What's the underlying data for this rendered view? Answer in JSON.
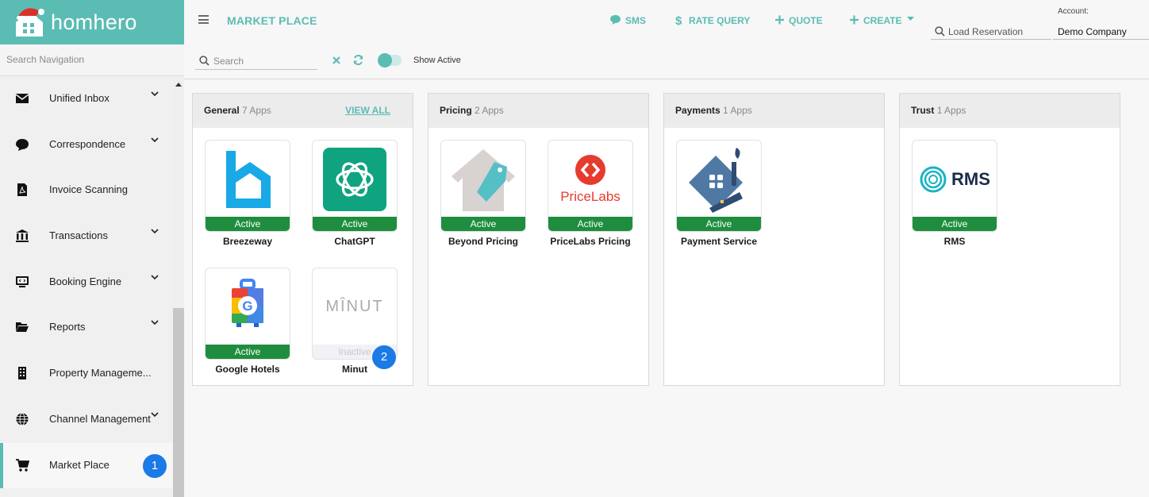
{
  "brand": {
    "name": "homhero",
    "accent": "#5bbcb4"
  },
  "sidebar": {
    "search_placeholder": "Search Navigation",
    "items": [
      {
        "label": "Unified Inbox",
        "icon": "envelope-icon",
        "has_chevron": true
      },
      {
        "label": "Correspondence",
        "icon": "chat-bubble-icon",
        "has_chevron": true
      },
      {
        "label": "Invoice Scanning",
        "icon": "pdf-file-icon",
        "has_chevron": false
      },
      {
        "label": "Transactions",
        "icon": "bank-icon",
        "has_chevron": true
      },
      {
        "label": "Booking Engine",
        "icon": "monitor-code-icon",
        "has_chevron": true
      },
      {
        "label": "Reports",
        "icon": "folder-open-icon",
        "has_chevron": true
      },
      {
        "label": "Property Manageme...",
        "icon": "building-icon",
        "has_chevron": false
      },
      {
        "label": "Channel Management",
        "icon": "globe-icon",
        "has_chevron": true
      },
      {
        "label": "Market Place",
        "icon": "cart-icon",
        "has_chevron": false,
        "active": true
      }
    ]
  },
  "header": {
    "title": "MARKET PLACE",
    "actions": {
      "sms": "SMS",
      "rate_query": "RATE QUERY",
      "quote": "QUOTE",
      "create": "CREATE"
    },
    "load_reservation_placeholder": "Load Reservation",
    "account_label": "Account:",
    "account_value": "Demo Company"
  },
  "filters": {
    "search_placeholder": "Search",
    "show_active_label": "Show Active",
    "show_active_on": true
  },
  "badges": {
    "one": "1",
    "two": "2"
  },
  "categories": [
    {
      "name": "General",
      "count": "7 Apps",
      "view_all": "VIEW ALL",
      "apps": [
        {
          "name": "Breezeway",
          "status": "Active"
        },
        {
          "name": "ChatGPT",
          "status": "Active"
        },
        {
          "name": "Google Hotels",
          "status": "Active"
        },
        {
          "name": "Minut",
          "status": "Inactive",
          "logo_text": "MÎNUT"
        }
      ]
    },
    {
      "name": "Pricing",
      "count": "2 Apps",
      "apps": [
        {
          "name": "Beyond Pricing",
          "status": "Active"
        },
        {
          "name": "PriceLabs Pricing",
          "status": "Active",
          "logo_text": "PriceLabs"
        }
      ]
    },
    {
      "name": "Payments",
      "count": "1 Apps",
      "apps": [
        {
          "name": "Payment Service",
          "status": "Active"
        }
      ]
    },
    {
      "name": "Trust",
      "count": "1 Apps",
      "apps": [
        {
          "name": "RMS",
          "status": "Active",
          "logo_text": "RMS"
        }
      ]
    }
  ],
  "colors": {
    "active_status": "#1e8e3e",
    "badge": "#1a7ae6",
    "sidebar_bg": "#f0f0f0"
  }
}
